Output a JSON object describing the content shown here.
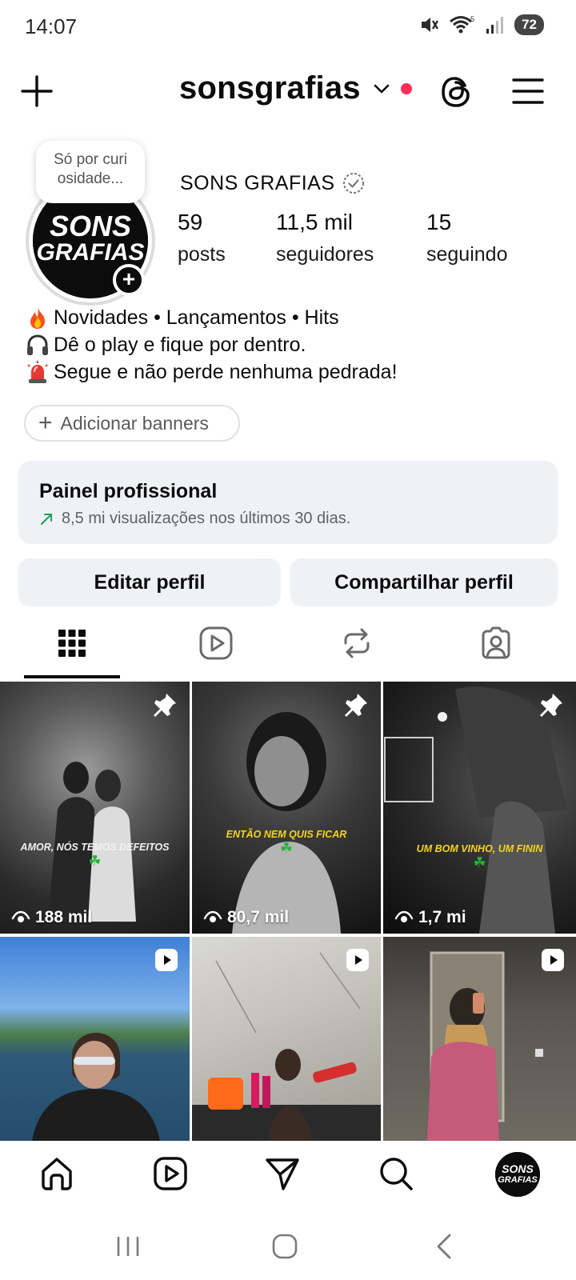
{
  "status": {
    "time": "14:07",
    "battery": "72",
    "wifi_badge": "5"
  },
  "header": {
    "username": "sonsgrafias",
    "icons": [
      "plus-icon",
      "chevron-down-icon",
      "notification-dot",
      "threads-icon",
      "hamburger-menu-icon"
    ]
  },
  "profile": {
    "note": "Só por curiosidade...",
    "note_line1": "Só por curi",
    "note_line2": "osidade...",
    "display_name": "SONS GRAFIAS",
    "avatar_text_line1": "SONS",
    "avatar_text_line2": "GRAFIAS",
    "stats": [
      {
        "value": "59",
        "label": "posts"
      },
      {
        "value": "11,5 mil",
        "label": "seguidores"
      },
      {
        "value": "15",
        "label": "seguindo"
      }
    ],
    "bio": [
      {
        "emoji": "fire-icon",
        "text": "Novidades • Lançamentos • Hits"
      },
      {
        "emoji": "headphones-icon",
        "text": "Dê o play e fique por dentro."
      },
      {
        "emoji": "siren-icon",
        "text": "Segue e não perde nenhuma pedrada!"
      }
    ],
    "add_banners": "Adicionar banners"
  },
  "pro_panel": {
    "title": "Painel profissional",
    "subtitle": "8,5 mi visualizações nos últimos 30 dias."
  },
  "actions": {
    "edit": "Editar perfil",
    "share": "Compartilhar perfil"
  },
  "tabs": [
    "grid-icon",
    "reels-icon",
    "reposts-icon",
    "tagged-icon"
  ],
  "posts": [
    {
      "caption": "AMOR, NÓS TEMOS DEFEITOS",
      "views": "188 mil",
      "pinned": true
    },
    {
      "caption": "ENTÃO NEM QUIS FICAR",
      "views": "80,7 mil",
      "pinned": true
    },
    {
      "caption": "UM BOM VINHO, UM FININ",
      "views": "1,7 mi",
      "pinned": true
    },
    {
      "caption": "",
      "views": "",
      "pinned": false
    },
    {
      "caption": "",
      "views": "",
      "pinned": false
    },
    {
      "caption": "",
      "views": "",
      "pinned": false
    }
  ],
  "bottom_nav": [
    "home-icon",
    "reels-icon",
    "direct-icon",
    "search-icon",
    "profile-avatar"
  ],
  "colors": {
    "accent_dot": "#ff2d55",
    "panel_bg": "#eff1f4",
    "text": "#0c0c0d",
    "clover": "#27b33b",
    "caption_yellow": "#f5d41a"
  }
}
